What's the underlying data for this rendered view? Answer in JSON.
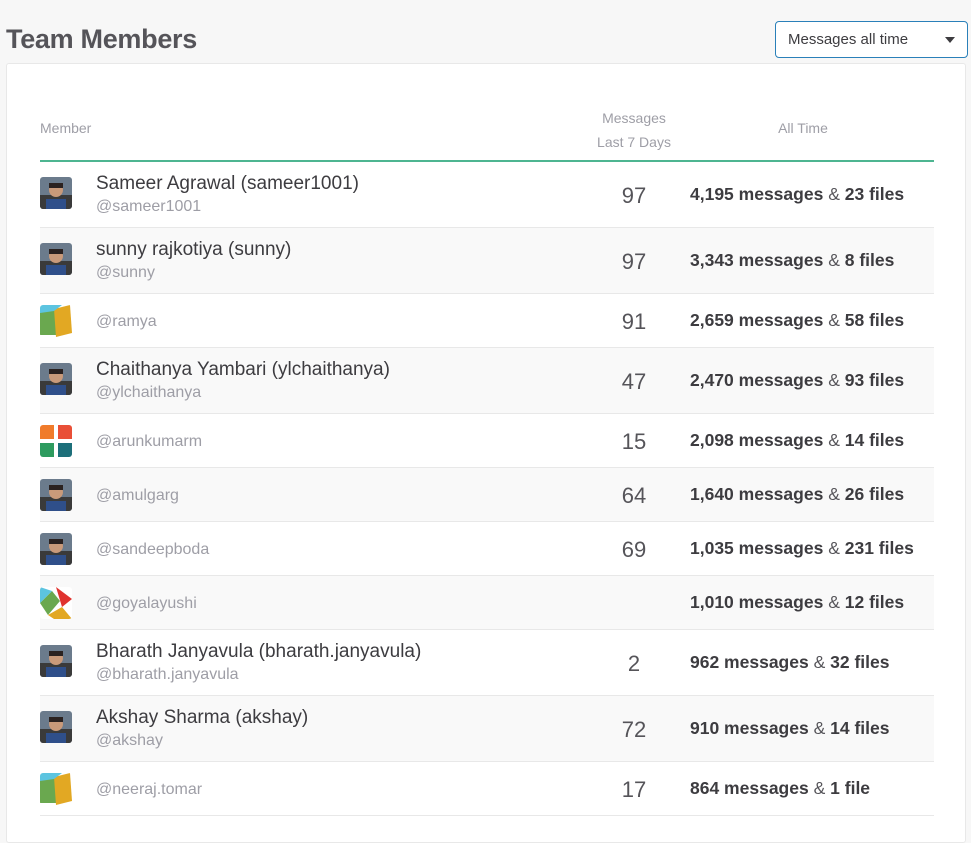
{
  "header": {
    "title": "Team Members"
  },
  "filter": {
    "selected": "Messages all time"
  },
  "table": {
    "col_member": "Member",
    "col_week_line1": "Messages",
    "col_week_line2": "Last 7 Days",
    "col_all": "All Time",
    "rows": [
      {
        "name": "Sameer Agrawal (sameer1001)",
        "handle": "@sameer1001",
        "week": "97",
        "messages": "4,195 messages",
        "amp": "&",
        "files": "23 files",
        "avatar": "photo-avatar"
      },
      {
        "name": "sunny rajkotiya (sunny)",
        "handle": "@sunny",
        "week": "97",
        "messages": "3,343 messages",
        "amp": "&",
        "files": "8 files",
        "avatar": "photo-avatar"
      },
      {
        "name": "",
        "handle": "@ramya",
        "week": "91",
        "messages": "2,659 messages",
        "amp": "&",
        "files": "58 files",
        "avatar": "default-avatar-green-yellow"
      },
      {
        "name": "Chaithanya Yambari (ylchaithanya)",
        "handle": "@ylchaithanya",
        "week": "47",
        "messages": "2,470 messages",
        "amp": "&",
        "files": "93 files",
        "avatar": "photo-avatar"
      },
      {
        "name": "",
        "handle": "@arunkumarm",
        "week": "15",
        "messages": "2,098 messages",
        "amp": "&",
        "files": "14 files",
        "avatar": "default-avatar-orange-teal"
      },
      {
        "name": "",
        "handle": "@amulgarg",
        "week": "64",
        "messages": "1,640 messages",
        "amp": "&",
        "files": "26 files",
        "avatar": "photo-avatar"
      },
      {
        "name": "",
        "handle": "@sandeepboda",
        "week": "69",
        "messages": "1,035 messages",
        "amp": "&",
        "files": "231 files",
        "avatar": "photo-avatar"
      },
      {
        "name": "",
        "handle": "@goyalayushi",
        "week": "",
        "messages": "1,010 messages",
        "amp": "&",
        "files": "12 files",
        "avatar": "default-avatar-multicolor"
      },
      {
        "name": "Bharath Janyavula (bharath.janyavula)",
        "handle": "@bharath.janyavula",
        "week": "2",
        "messages": "962 messages",
        "amp": "&",
        "files": "32 files",
        "avatar": "photo-avatar"
      },
      {
        "name": "Akshay Sharma (akshay)",
        "handle": "@akshay",
        "week": "72",
        "messages": "910 messages",
        "amp": "&",
        "files": "14 files",
        "avatar": "photo-avatar"
      },
      {
        "name": "",
        "handle": "@neeraj.tomar",
        "week": "17",
        "messages": "864 messages",
        "amp": "&",
        "files": "1 file",
        "avatar": "default-avatar-green-yellow"
      }
    ]
  },
  "colors": {
    "accent_border": "#4db591",
    "select_border": "#2a80b9",
    "muted_text": "#9e9ea6"
  }
}
